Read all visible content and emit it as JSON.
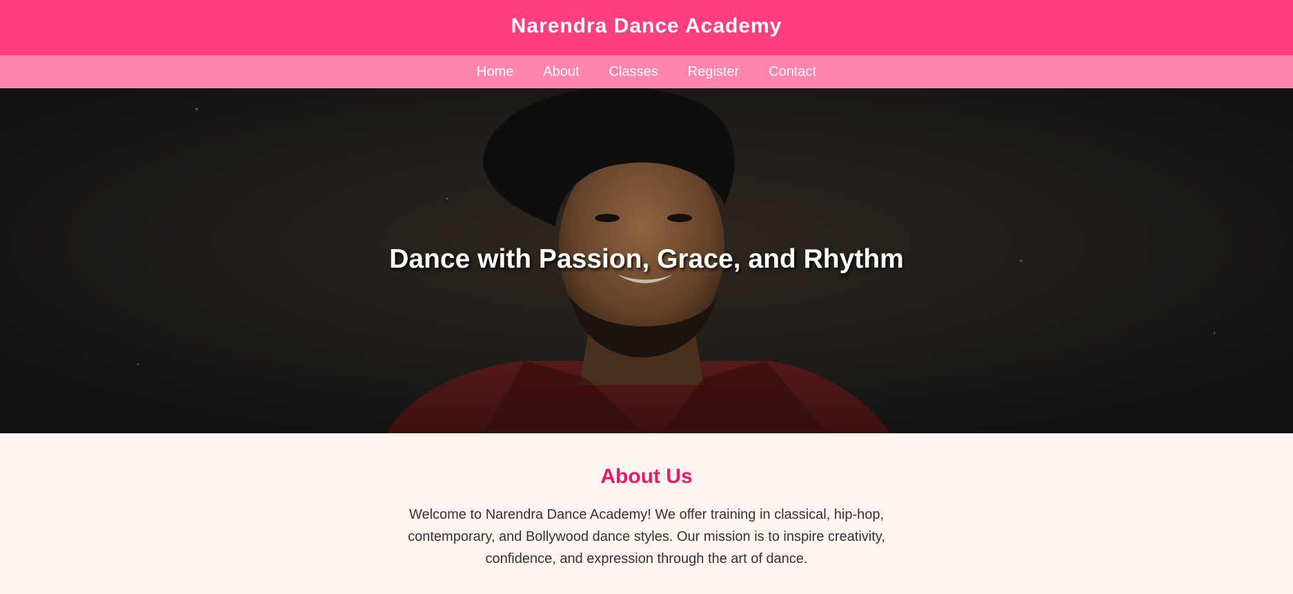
{
  "header": {
    "title": "Narendra Dance Academy"
  },
  "nav": {
    "items": [
      {
        "label": "Home"
      },
      {
        "label": "About"
      },
      {
        "label": "Classes"
      },
      {
        "label": "Register"
      },
      {
        "label": "Contact"
      }
    ]
  },
  "hero": {
    "heading": "Dance with Passion, Grace, and Rhythm"
  },
  "about": {
    "title": "About Us",
    "text": "Welcome to Narendra Dance Academy! We offer training in classical, hip-hop, contemporary, and Bollywood dance styles. Our mission is to inspire creativity, confidence, and expression through the art of dance."
  },
  "colors": {
    "header_bg": "#ff3e7d",
    "nav_bg": "#ff85ad",
    "accent_heading": "#e8186a",
    "section_bg": "#fdf4ef"
  }
}
